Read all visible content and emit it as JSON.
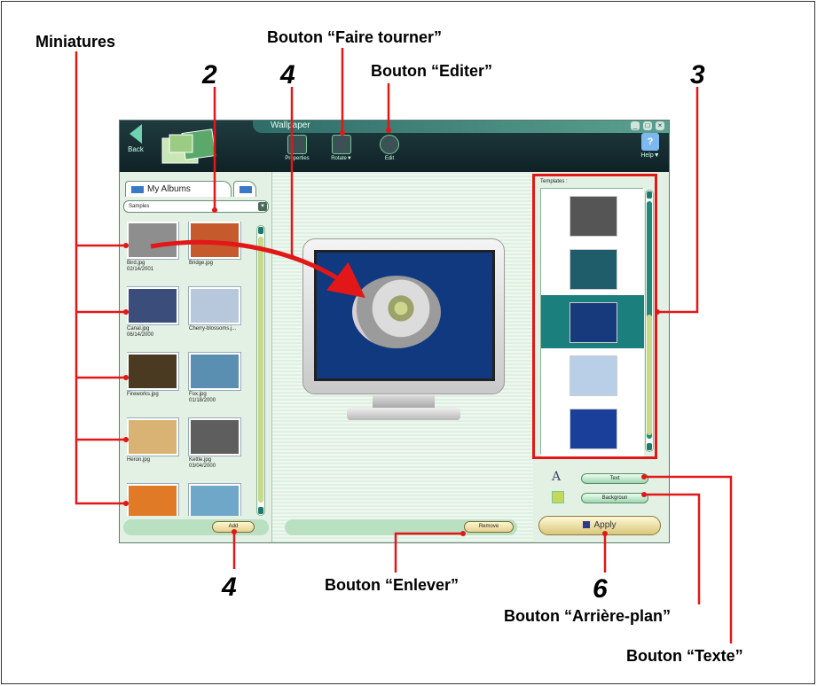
{
  "annotations": {
    "miniatures": "Miniatures",
    "rotate_button": "Bouton “Faire tourner”",
    "edit_button": "Bouton “Editer”",
    "remove_button": "Bouton “Enlever”",
    "background_button": "Bouton “Arrière-plan”",
    "text_button": "Bouton “Texte”",
    "numbers": {
      "n2": "2",
      "n4_top": "4",
      "n3": "3",
      "n4_bottom": "4",
      "n6": "6"
    }
  },
  "window": {
    "title": "Wallpaper",
    "controls": [
      "_",
      "□",
      "×"
    ],
    "back_label": "Back",
    "toolbar": {
      "properties": "Properties",
      "rotate": "Rotate▼",
      "edit": "Edit",
      "help": "Help▼"
    }
  },
  "left_panel": {
    "tab_label": "My Albums",
    "album_select": "Samples",
    "thumbnails": [
      {
        "caption": "Bird.jpg\n02/14/2001",
        "color": "#8e8e8e"
      },
      {
        "caption": "Bridge.jpg",
        "color": "#c55b2c"
      },
      {
        "caption": "Canal.jpg\n06/14/2000",
        "color": "#3b4d7a"
      },
      {
        "caption": "Cherry-blossoms.j...",
        "color": "#b7c7dc"
      },
      {
        "caption": "Fireworks.jpg",
        "color": "#4a3a22"
      },
      {
        "caption": "Fox.jpg\n01/18/2000",
        "color": "#5b8fb2"
      },
      {
        "caption": "Heron.jpg",
        "color": "#d8b373"
      },
      {
        "caption": "Kettle.jpg\n03/04/2000",
        "color": "#5e5e5e"
      },
      {
        "caption": "",
        "color": "#e07a26"
      },
      {
        "caption": "",
        "color": "#6fa7c9"
      }
    ],
    "add_label": "Add"
  },
  "center_panel": {
    "remove_label": "Remove"
  },
  "right_panel": {
    "templates_label": "Templates :",
    "templates": [
      {
        "bg": "#ffffff",
        "fg": "#555555"
      },
      {
        "bg": "#ffffff",
        "fg": "#1f5d6b"
      },
      {
        "bg": "#1b7f7d",
        "fg": "#173a7c"
      },
      {
        "bg": "#ffffff",
        "fg": "#b9cfe8"
      },
      {
        "bg": "#ffffff",
        "fg": "#1a3f9a"
      }
    ],
    "text_label": "Text",
    "background_label": "Backgroun",
    "apply_label": "Apply"
  },
  "colors": {
    "annotation_red": "#e21818"
  }
}
